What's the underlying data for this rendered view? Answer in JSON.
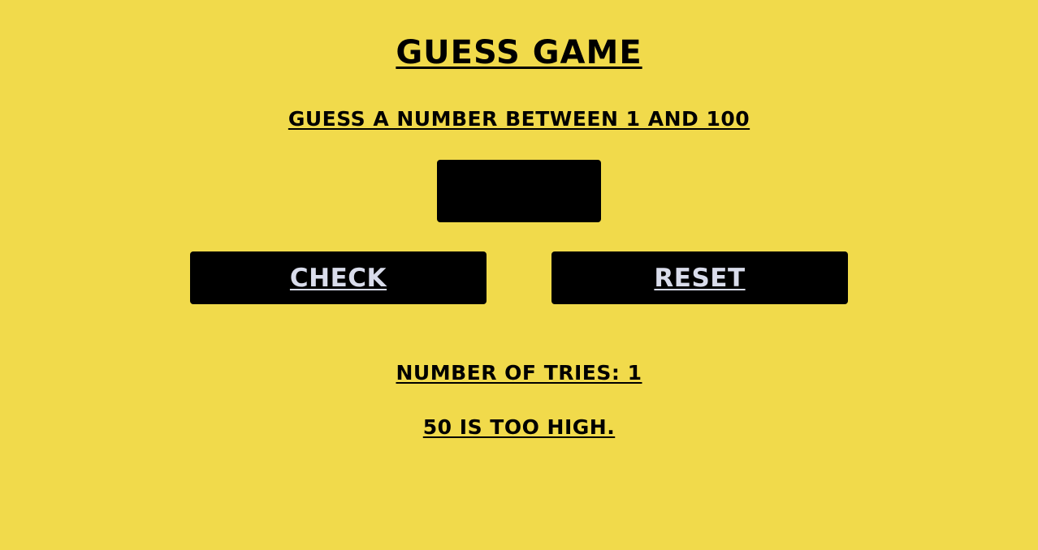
{
  "header": {
    "title": "GUESS GAME",
    "instruction": "GUESS A NUMBER BETWEEN 1 AND 100"
  },
  "guess_input": {
    "value": ""
  },
  "buttons": {
    "check_label": "CHECK",
    "reset_label": "RESET"
  },
  "status": {
    "tries_text": "NUMBER OF TRIES: 1",
    "message_text": "50 IS TOO HIGH."
  },
  "colors": {
    "background": "#f1da4b",
    "button_background": "#000000",
    "button_text": "#d9dceb",
    "text": "#000000"
  }
}
